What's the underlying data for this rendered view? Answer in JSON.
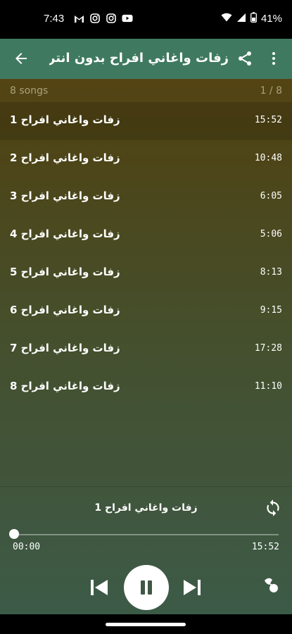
{
  "status": {
    "time": "7:43",
    "battery": "41%",
    "icons": [
      "gmail-icon",
      "instagram-icon",
      "instagram-icon",
      "youtube-icon",
      "wifi-icon",
      "signal-icon",
      "battery-icon"
    ]
  },
  "appbar": {
    "title": "زفات واغاني افراح بدون انترنت ...",
    "icons": [
      "back-arrow-icon",
      "share-icon",
      "more-vert-icon"
    ]
  },
  "list_header": {
    "count": "8 songs",
    "position": "1 / 8"
  },
  "songs": [
    {
      "title": "زفات واغاني افراح 1",
      "duration": "15:52"
    },
    {
      "title": "زفات واغاني افراح 2",
      "duration": "10:48"
    },
    {
      "title": "زفات واغاني افراح 3",
      "duration": "6:05"
    },
    {
      "title": "زفات واغاني افراح 4",
      "duration": "5:06"
    },
    {
      "title": "زفات واغاني افراح 5",
      "duration": "8:13"
    },
    {
      "title": "زفات واغاني افراح 6",
      "duration": "9:15"
    },
    {
      "title": "زفات واغاني افراح 7",
      "duration": "17:28"
    },
    {
      "title": "زفات واغاني افراح 8",
      "duration": "11:10"
    }
  ],
  "player": {
    "now_playing": "زفات واغاني افراح 1",
    "elapsed": "00:00",
    "total": "15:52",
    "progress": 0,
    "controls": [
      "repeat-icon",
      "previous-icon",
      "pause-icon",
      "next-icon",
      "favorite-icon"
    ]
  },
  "colors": {
    "appbar": "#3f7a60",
    "background_top": "#5b4310",
    "background_bottom": "#3b5c49",
    "play_button": "#ffffff"
  }
}
